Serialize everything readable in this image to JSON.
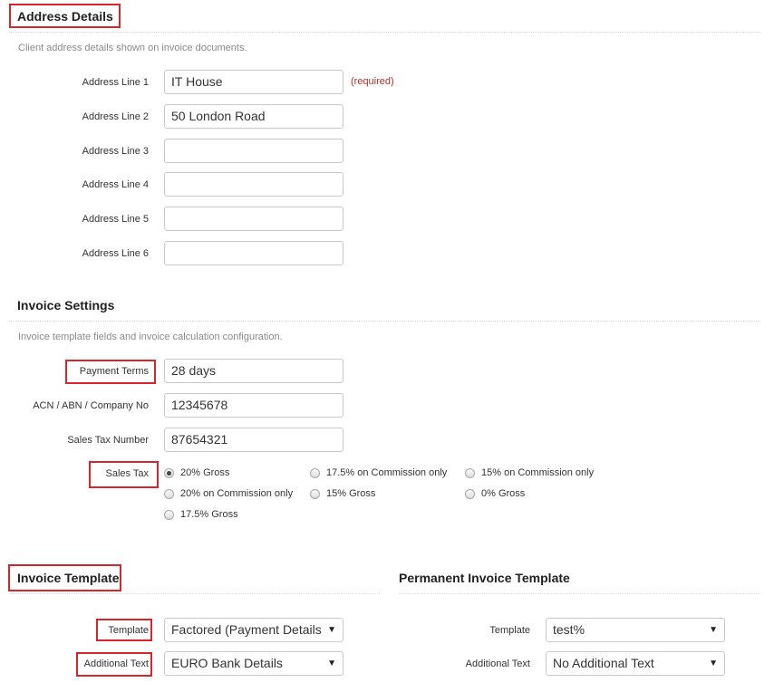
{
  "address": {
    "title": "Address Details",
    "description": "Client address details shown on invoice documents.",
    "required_note": "(required)",
    "fields": [
      {
        "label": "Address Line 1",
        "value": "IT House"
      },
      {
        "label": "Address Line 2",
        "value": "50 London Road"
      },
      {
        "label": "Address Line 3",
        "value": ""
      },
      {
        "label": "Address Line 4",
        "value": ""
      },
      {
        "label": "Address Line 5",
        "value": ""
      },
      {
        "label": "Address Line 6",
        "value": ""
      }
    ]
  },
  "invoice_settings": {
    "title": "Invoice Settings",
    "description": "Invoice template fields and invoice calculation configuration.",
    "payment_terms": {
      "label": "Payment Terms",
      "value": "28 days"
    },
    "company_no": {
      "label": "ACN / ABN / Company No",
      "value": "12345678"
    },
    "sales_tax_number": {
      "label": "Sales Tax Number",
      "value": "87654321"
    },
    "sales_tax": {
      "label": "Sales Tax",
      "selected": "20% Gross",
      "options": [
        "20% Gross",
        "17.5% on Commission only",
        "15% on Commission only",
        "20% on Commission only",
        "15% Gross",
        "0% Gross",
        "17.5% Gross"
      ]
    }
  },
  "invoice_template": {
    "title": "Invoice Template",
    "template": {
      "label": "Template",
      "value": "Factored (Payment Details F"
    },
    "additional_text": {
      "label": "Additional Text",
      "value": "EURO Bank Details"
    }
  },
  "permanent_template": {
    "title": "Permanent Invoice Template",
    "template": {
      "label": "Template",
      "value": "test%"
    },
    "additional_text": {
      "label": "Additional Text",
      "value": "No Additional Text"
    }
  },
  "icons": {
    "caret": "▼"
  },
  "colors": {
    "highlight": "#d7252c",
    "required": "#b0302b"
  }
}
